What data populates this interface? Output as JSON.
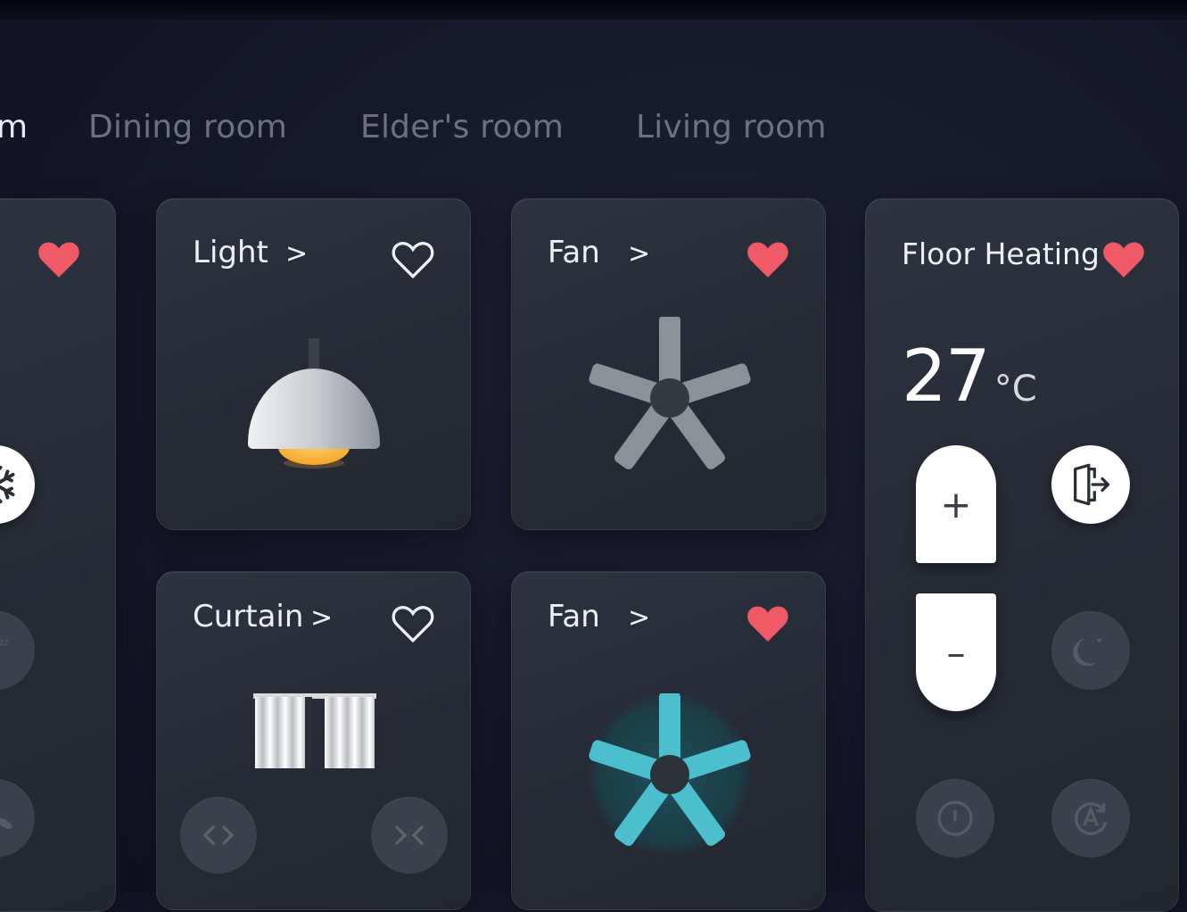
{
  "tabs": [
    {
      "label": "m",
      "active": true
    },
    {
      "label": "Dining room",
      "active": false
    },
    {
      "label": "Elder's room",
      "active": false
    },
    {
      "label": "Living room",
      "active": false
    }
  ],
  "cards": {
    "left_partial": {
      "favorite": true,
      "icons": [
        "snowflake-icon",
        "sleep-moon-icon",
        "fan-mode-icon"
      ]
    },
    "light": {
      "title": "Light",
      "chevron": ">",
      "favorite": false
    },
    "fan_top": {
      "title": "Fan",
      "chevron": ">",
      "favorite": true
    },
    "curtain": {
      "title": "Curtain",
      "chevron": ">",
      "favorite": false
    },
    "fan_bottom": {
      "title": "Fan",
      "chevron": ">",
      "favorite": true,
      "active_color": "#4bbfcc"
    },
    "floor_heating": {
      "title": "Floor Heating",
      "favorite": true,
      "temperature": "27",
      "unit": "°C",
      "increase_label": "+",
      "decrease_label": "–"
    }
  },
  "colors": {
    "heart": "#f05a67",
    "bulb": "#f4a92a",
    "fan_active": "#4bbfcc"
  }
}
